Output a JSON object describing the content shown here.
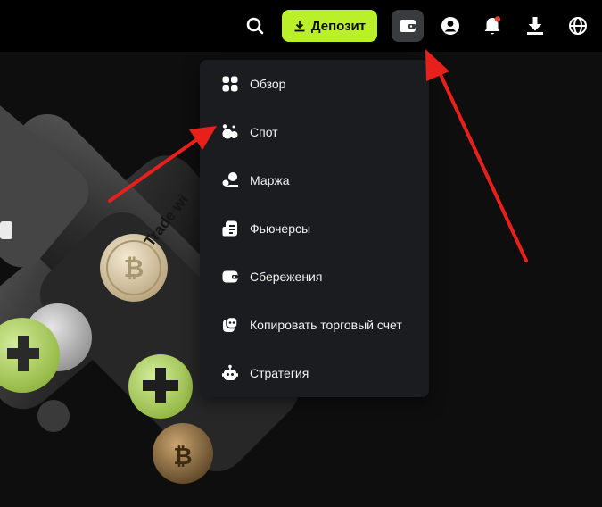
{
  "header": {
    "deposit_label": "Депозит",
    "icons": [
      "search-icon",
      "download-icon",
      "wallet-icon",
      "profile-icon",
      "bell-icon",
      "app-download-icon",
      "globe-icon"
    ]
  },
  "hero": {
    "card_text": "Trade wi"
  },
  "wallet_menu": {
    "items": [
      {
        "label": "Обзор",
        "icon": "grid-icon"
      },
      {
        "label": "Спот",
        "icon": "spot-icon"
      },
      {
        "label": "Маржа",
        "icon": "margin-icon"
      },
      {
        "label": "Фьючерсы",
        "icon": "futures-icon"
      },
      {
        "label": "Сбережения",
        "icon": "savings-icon"
      },
      {
        "label": "Копировать торговый счет",
        "icon": "copy-trading-icon"
      },
      {
        "label": "Стратегия",
        "icon": "strategy-bot-icon"
      }
    ]
  },
  "colors": {
    "accent": "#b9f02a",
    "annotation_arrow": "#e8201c",
    "menu_bg": "#1b1c1f",
    "topbar_bg": "#000000"
  }
}
